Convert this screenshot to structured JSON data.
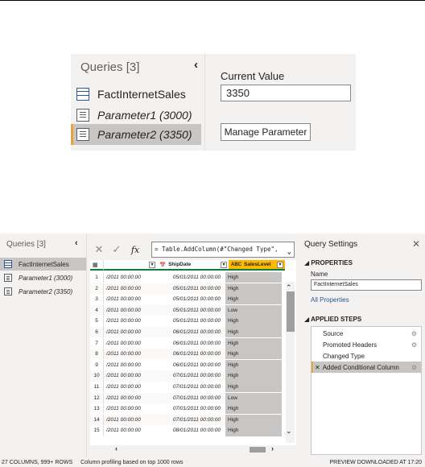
{
  "zoom_panel": {
    "queries_title": "Queries [3]",
    "collapse_glyph": "‹",
    "queries": [
      {
        "label": "FactInternetSales",
        "icon": "table-icon"
      },
      {
        "label": "Parameter1 (3000)",
        "icon": "parameter-icon"
      },
      {
        "label": "Parameter2 (3350)",
        "icon": "parameter-icon",
        "selected": true
      }
    ],
    "current_value_label": "Current Value",
    "current_value": "3350",
    "manage_button": "Manage Parameter"
  },
  "editor": {
    "queries_title": "Queries [3]",
    "collapse_glyph": "‹",
    "queries": [
      {
        "label": "FactInternetSales",
        "icon": "table-icon",
        "selected": true
      },
      {
        "label": "Parameter1 (3000)",
        "icon": "parameter-icon"
      },
      {
        "label": "Parameter2 (3350)",
        "icon": "parameter-icon"
      }
    ],
    "formula_bar": {
      "cancel_glyph": "✕",
      "commit_glyph": "✓",
      "fx": "fx",
      "formula": "= Table.AddColumn(#\"Changed Type\",",
      "expand_glyph": "⌄"
    },
    "columns": [
      "",
      "ShipDate",
      "SalesLevel"
    ],
    "rows": [
      {
        "n": "1",
        "a": "/2011 00:00:00",
        "b": "05/01/2011 00:00:00",
        "c": "High"
      },
      {
        "n": "2",
        "a": "/2011 00:00:00",
        "b": "05/01/2011 00:00:00",
        "c": "High"
      },
      {
        "n": "3",
        "a": "/2011 00:00:00",
        "b": "05/01/2011 00:00:00",
        "c": "High"
      },
      {
        "n": "4",
        "a": "/2011 00:00:00",
        "b": "05/01/2011 00:00:00",
        "c": "Low"
      },
      {
        "n": "5",
        "a": "/2011 00:00:00",
        "b": "05/01/2011 00:00:00",
        "c": "High"
      },
      {
        "n": "6",
        "a": "/2011 00:00:00",
        "b": "06/01/2011 00:00:00",
        "c": "High"
      },
      {
        "n": "7",
        "a": "/2011 00:00:00",
        "b": "06/01/2011 00:00:00",
        "c": "High"
      },
      {
        "n": "8",
        "a": "/2011 00:00:00",
        "b": "06/01/2011 00:00:00",
        "c": "High"
      },
      {
        "n": "9",
        "a": "/2011 00:00:00",
        "b": "06/01/2011 00:00:00",
        "c": "High"
      },
      {
        "n": "10",
        "a": "/2011 00:00:00",
        "b": "07/01/2011 00:00:00",
        "c": "High"
      },
      {
        "n": "11",
        "a": "/2011 00:00:00",
        "b": "07/01/2011 00:00:00",
        "c": "High"
      },
      {
        "n": "12",
        "a": "/2011 00:00:00",
        "b": "07/01/2011 00:00:00",
        "c": "Low"
      },
      {
        "n": "13",
        "a": "/2011 00:00:00",
        "b": "07/01/2011 00:00:00",
        "c": "High"
      },
      {
        "n": "14",
        "a": "/2011 00:00:00",
        "b": "07/01/2011 00:00:00",
        "c": "High"
      },
      {
        "n": "15",
        "a": "/2011 00:00:00",
        "b": "08/01/2011 00:00:00",
        "c": "High"
      }
    ],
    "settings": {
      "title": "Query Settings",
      "close_glyph": "✕",
      "properties_header": "PROPERTIES",
      "name_label": "Name",
      "name_value": "FactInternetSales",
      "all_properties_link": "All Properties",
      "applied_steps_header": "APPLIED STEPS",
      "steps": [
        {
          "label": "Source",
          "gear": true
        },
        {
          "label": "Promoted Headers",
          "gear": true
        },
        {
          "label": "Changed Type",
          "gear": false
        },
        {
          "label": "Added Conditional Column",
          "gear": true,
          "selected": true
        }
      ]
    },
    "status": {
      "columns_rows": "27 COLUMNS, 999+ ROWS",
      "profiling": "Column profiling based on top 1000 rows",
      "preview": "PREVIEW DOWNLOADED AT 17:20"
    }
  }
}
